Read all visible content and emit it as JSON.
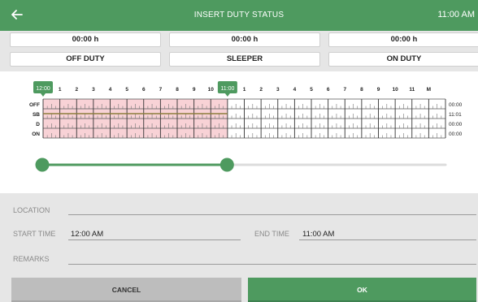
{
  "header": {
    "title": "INSERT DUTY STATUS",
    "time": "11:00 AM",
    "back_icon": "arrow-left-icon"
  },
  "totals": [
    {
      "hours": "00:00 h",
      "status": "OFF DUTY"
    },
    {
      "hours": "00:00 h",
      "status": "SLEEPER"
    },
    {
      "hours": "00:00 h",
      "status": "ON DUTY"
    }
  ],
  "grid": {
    "hour_labels": [
      "1",
      "2",
      "3",
      "4",
      "5",
      "6",
      "7",
      "8",
      "9",
      "10",
      "N",
      "1",
      "2",
      "3",
      "4",
      "5",
      "6",
      "7",
      "8",
      "9",
      "10",
      "11",
      "M"
    ],
    "start_marker": "12:00",
    "end_marker": "11:00",
    "rows": [
      {
        "label": "OFF",
        "total": "00:00"
      },
      {
        "label": "SB",
        "total": "11:01"
      },
      {
        "label": "D",
        "total": "00:00"
      },
      {
        "label": "ON",
        "total": "00:00"
      }
    ],
    "selection_start_hour": 0,
    "selection_end_hour": 11,
    "status_row_index": 1,
    "colors": {
      "accent": "#4e9a5f",
      "selection": "#f8d2d6",
      "status_line": "#8c7c3c"
    }
  },
  "slider": {
    "start_fraction": 0,
    "end_fraction": 0.4583
  },
  "form": {
    "location_label": "LOCATION",
    "location_value": "",
    "start_label": "START TIME",
    "start_value": "12:00 AM",
    "end_label": "END TIME",
    "end_value": "11:00 AM",
    "remarks_label": "REMARKS",
    "remarks_value": ""
  },
  "buttons": {
    "cancel": "CANCEL",
    "ok": "OK"
  }
}
